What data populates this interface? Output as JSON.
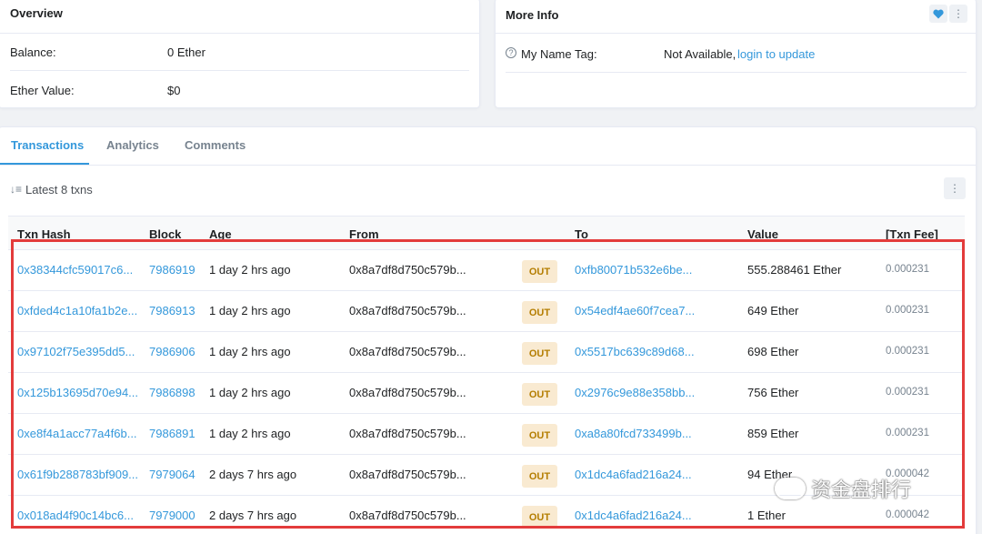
{
  "overview": {
    "title": "Overview",
    "balance_label": "Balance:",
    "balance_value": "0 Ether",
    "ether_value_label": "Ether Value:",
    "ether_value": "$0"
  },
  "more_info": {
    "title": "More Info",
    "name_tag_label": "My Name Tag:",
    "name_tag_value": "Not Available,",
    "login_link": "login to update"
  },
  "tabs": [
    {
      "label": "Transactions",
      "active": true
    },
    {
      "label": "Analytics",
      "active": false
    },
    {
      "label": "Comments",
      "active": false
    }
  ],
  "txn_summary": "Latest 8 txns",
  "columns": [
    "Txn Hash",
    "Block",
    "Age",
    "From",
    "To",
    "Value",
    "[Txn Fee]"
  ],
  "rows": [
    {
      "hash": "0x38344cfc59017c6...",
      "block": "7986919",
      "age": "1 day 2 hrs ago",
      "from": "0x8a7df8d750c579b...",
      "dir": "OUT",
      "to": "0xfb80071b532e6be...",
      "value": "555.288461 Ether",
      "fee": "0.000231"
    },
    {
      "hash": "0xfded4c1a10fa1b2e...",
      "block": "7986913",
      "age": "1 day 2 hrs ago",
      "from": "0x8a7df8d750c579b...",
      "dir": "OUT",
      "to": "0x54edf4ae60f7cea7...",
      "value": "649 Ether",
      "fee": "0.000231"
    },
    {
      "hash": "0x97102f75e395dd5...",
      "block": "7986906",
      "age": "1 day 2 hrs ago",
      "from": "0x8a7df8d750c579b...",
      "dir": "OUT",
      "to": "0x5517bc639c89d68...",
      "value": "698 Ether",
      "fee": "0.000231"
    },
    {
      "hash": "0x125b13695d70e94...",
      "block": "7986898",
      "age": "1 day 2 hrs ago",
      "from": "0x8a7df8d750c579b...",
      "dir": "OUT",
      "to": "0x2976c9e88e358bb...",
      "value": "756 Ether",
      "fee": "0.000231"
    },
    {
      "hash": "0xe8f4a1acc77a4f6b...",
      "block": "7986891",
      "age": "1 day 2 hrs ago",
      "from": "0x8a7df8d750c579b...",
      "dir": "OUT",
      "to": "0xa8a80fcd733499b...",
      "value": "859 Ether",
      "fee": "0.000231"
    },
    {
      "hash": "0x61f9b288783bf909...",
      "block": "7979064",
      "age": "2 days 7 hrs ago",
      "from": "0x8a7df8d750c579b...",
      "dir": "OUT",
      "to": "0x1dc4a6fad216a24...",
      "value": "94 Ether",
      "fee": "0.000042"
    },
    {
      "hash": "0x018ad4f90c14bc6...",
      "block": "7979000",
      "age": "2 days 7 hrs ago",
      "from": "0x8a7df8d750c579b...",
      "dir": "OUT",
      "to": "0x1dc4a6fad216a24...",
      "value": "1 Ether",
      "fee": "0.000042"
    }
  ],
  "watermark": "资金盘排行",
  "icons": {
    "favorite": "heart-icon",
    "more": "more-vertical-icon",
    "sort": "sort-icon",
    "help": "question-circle-icon"
  },
  "colors": {
    "link": "#3498db",
    "out_badge_bg": "#f9ead1",
    "out_badge_text": "#b47d00",
    "highlight_border": "#e33b3b"
  }
}
